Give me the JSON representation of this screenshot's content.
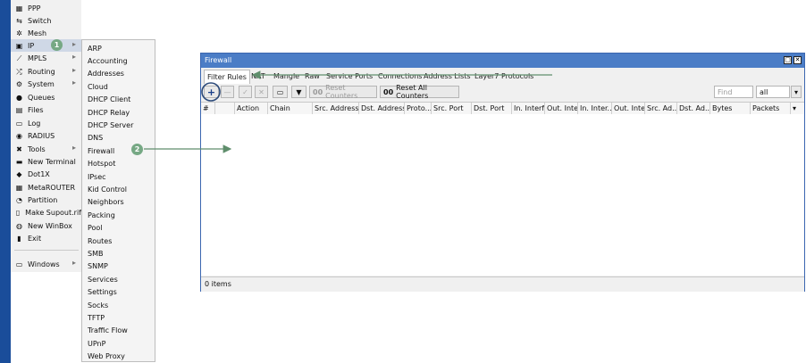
{
  "colors": {
    "sidebar_strip": "#1a4d9a",
    "title_bar": "#4b7dc6",
    "badge": "#76a884",
    "arrow": "#5f8e6c"
  },
  "menu": {
    "items": [
      {
        "label": "PPP",
        "icon": "ppp-icon",
        "glyph": "▦"
      },
      {
        "label": "Switch",
        "icon": "switch-icon",
        "glyph": "⇆"
      },
      {
        "label": "Mesh",
        "icon": "mesh-icon",
        "glyph": "✲"
      },
      {
        "label": "IP",
        "icon": "ip-icon",
        "glyph": "▣",
        "has_submenu": true
      },
      {
        "label": "MPLS",
        "icon": "mpls-icon",
        "glyph": "⟋",
        "has_submenu": true
      },
      {
        "label": "Routing",
        "icon": "routing-icon",
        "glyph": "⤮",
        "has_submenu": true
      },
      {
        "label": "System",
        "icon": "system-icon",
        "glyph": "⚙",
        "has_submenu": true
      },
      {
        "label": "Queues",
        "icon": "queues-icon",
        "glyph": "●"
      },
      {
        "label": "Files",
        "icon": "files-icon",
        "glyph": "▤"
      },
      {
        "label": "Log",
        "icon": "log-icon",
        "glyph": "▭"
      },
      {
        "label": "RADIUS",
        "icon": "radius-icon",
        "glyph": "◉"
      },
      {
        "label": "Tools",
        "icon": "tools-icon",
        "glyph": "✖",
        "has_submenu": true
      },
      {
        "label": "New Terminal",
        "icon": "terminal-icon",
        "glyph": "▬"
      },
      {
        "label": "Dot1X",
        "icon": "dot1x-icon",
        "glyph": "◆"
      },
      {
        "label": "MetaROUTER",
        "icon": "metarouter-icon",
        "glyph": "▦"
      },
      {
        "label": "Partition",
        "icon": "partition-icon",
        "glyph": "◔"
      },
      {
        "label": "Make Supout.rif",
        "icon": "supout-icon",
        "glyph": "▯"
      },
      {
        "label": "New WinBox",
        "icon": "winbox-icon",
        "glyph": "◍"
      },
      {
        "label": "Exit",
        "icon": "exit-icon",
        "glyph": "▮"
      },
      {
        "label": "Windows",
        "icon": "windows-icon",
        "glyph": "▭",
        "has_submenu": true
      }
    ]
  },
  "badges": {
    "step1": "1",
    "step2": "2"
  },
  "submenu": {
    "items": [
      "ARP",
      "Accounting",
      "Addresses",
      "Cloud",
      "DHCP Client",
      "DHCP Relay",
      "DHCP Server",
      "DNS",
      "Firewall",
      "Hotspot",
      "IPsec",
      "Kid Control",
      "Neighbors",
      "Packing",
      "Pool",
      "Routes",
      "SMB",
      "SNMP",
      "Services",
      "Settings",
      "Socks",
      "TFTP",
      "Traffic Flow",
      "UPnP",
      "Web Proxy"
    ]
  },
  "firewall": {
    "title": "Firewall",
    "tabs": [
      "Filter Rules",
      "NAT",
      "Mangle",
      "Raw",
      "Service Ports",
      "Connections",
      "Address Lists",
      "Layer7 Protocols"
    ],
    "toolbar": {
      "add": "+",
      "remove": "—",
      "enable": "✓",
      "disable": "✕",
      "comment": "▭",
      "filter": "▼",
      "reset_counters": "Reset Counters",
      "reset_all_counters": "Reset All Counters",
      "counter_glyph": "00",
      "find_placeholder": "Find",
      "select_value": "all",
      "dropdown": "▾"
    },
    "columns": [
      "#",
      "",
      "Action",
      "Chain",
      "Src. Address",
      "Dst. Address",
      "Proto...",
      "Src. Port",
      "Dst. Port",
      "In. Interf...",
      "Out. Inte...",
      "In. Inter...",
      "Out. Inte...",
      "Src. Ad...",
      "Dst. Ad...",
      "Bytes",
      "Packets"
    ],
    "status": "0 items",
    "window_buttons": {
      "restore": "▢",
      "close": "✕"
    }
  }
}
